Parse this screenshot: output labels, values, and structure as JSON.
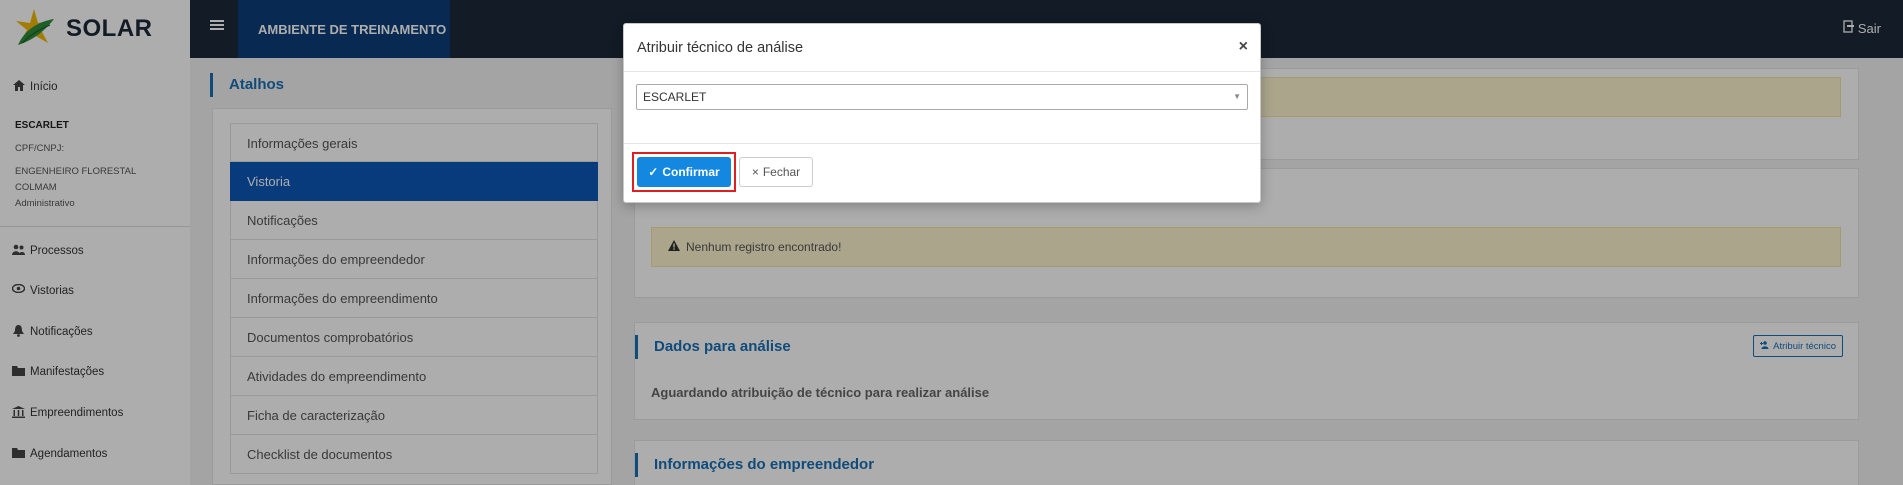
{
  "header": {
    "logo_text": "SOLAR",
    "environment": "AMBIENTE DE TREINAMENTO",
    "logout": "Sair"
  },
  "sidebar": {
    "home": "Início",
    "user": {
      "name": "ESCARLET",
      "cpf": "CPF/CNPJ:",
      "role": "ENGENHEIRO FLORESTAL",
      "org": "COLMAM",
      "profile": "Administrativo"
    },
    "items": [
      {
        "label": "Processos",
        "icon": "users-icon"
      },
      {
        "label": "Vistorias",
        "icon": "eye-icon"
      },
      {
        "label": "Notificações",
        "icon": "bell-icon"
      },
      {
        "label": "Manifestações",
        "icon": "folder-icon"
      },
      {
        "label": "Empreendimentos",
        "icon": "bank-icon"
      },
      {
        "label": "Agendamentos",
        "icon": "calendar-icon"
      }
    ]
  },
  "atalhos": {
    "title": "Atalhos",
    "items": [
      "Informações gerais",
      "Vistoria",
      "Notificações",
      "Informações do empreendedor",
      "Informações do empreendimento",
      "Documentos comprobatórios",
      "Atividades do empreendimento",
      "Ficha de caracterização",
      "Checklist de documentos"
    ],
    "active_index": 1
  },
  "main": {
    "no_records": "Nenhum registro encontrado!",
    "dados_title": "Dados para análise",
    "assign_button": "Atribuir técnico",
    "awaiting_text": "Aguardando atribuição de técnico para realizar análise",
    "empreendedor_title": "Informações do empreendedor"
  },
  "modal": {
    "title": "Atribuir técnico de análise",
    "selected_value": "ESCARLET",
    "confirm": "Confirmar",
    "close": "Fechar"
  },
  "colors": {
    "topbar": "#1b2838",
    "accent": "#1a6fb3",
    "active": "#0d57b6",
    "confirm": "#1487e0",
    "highlight": "#e02020"
  }
}
